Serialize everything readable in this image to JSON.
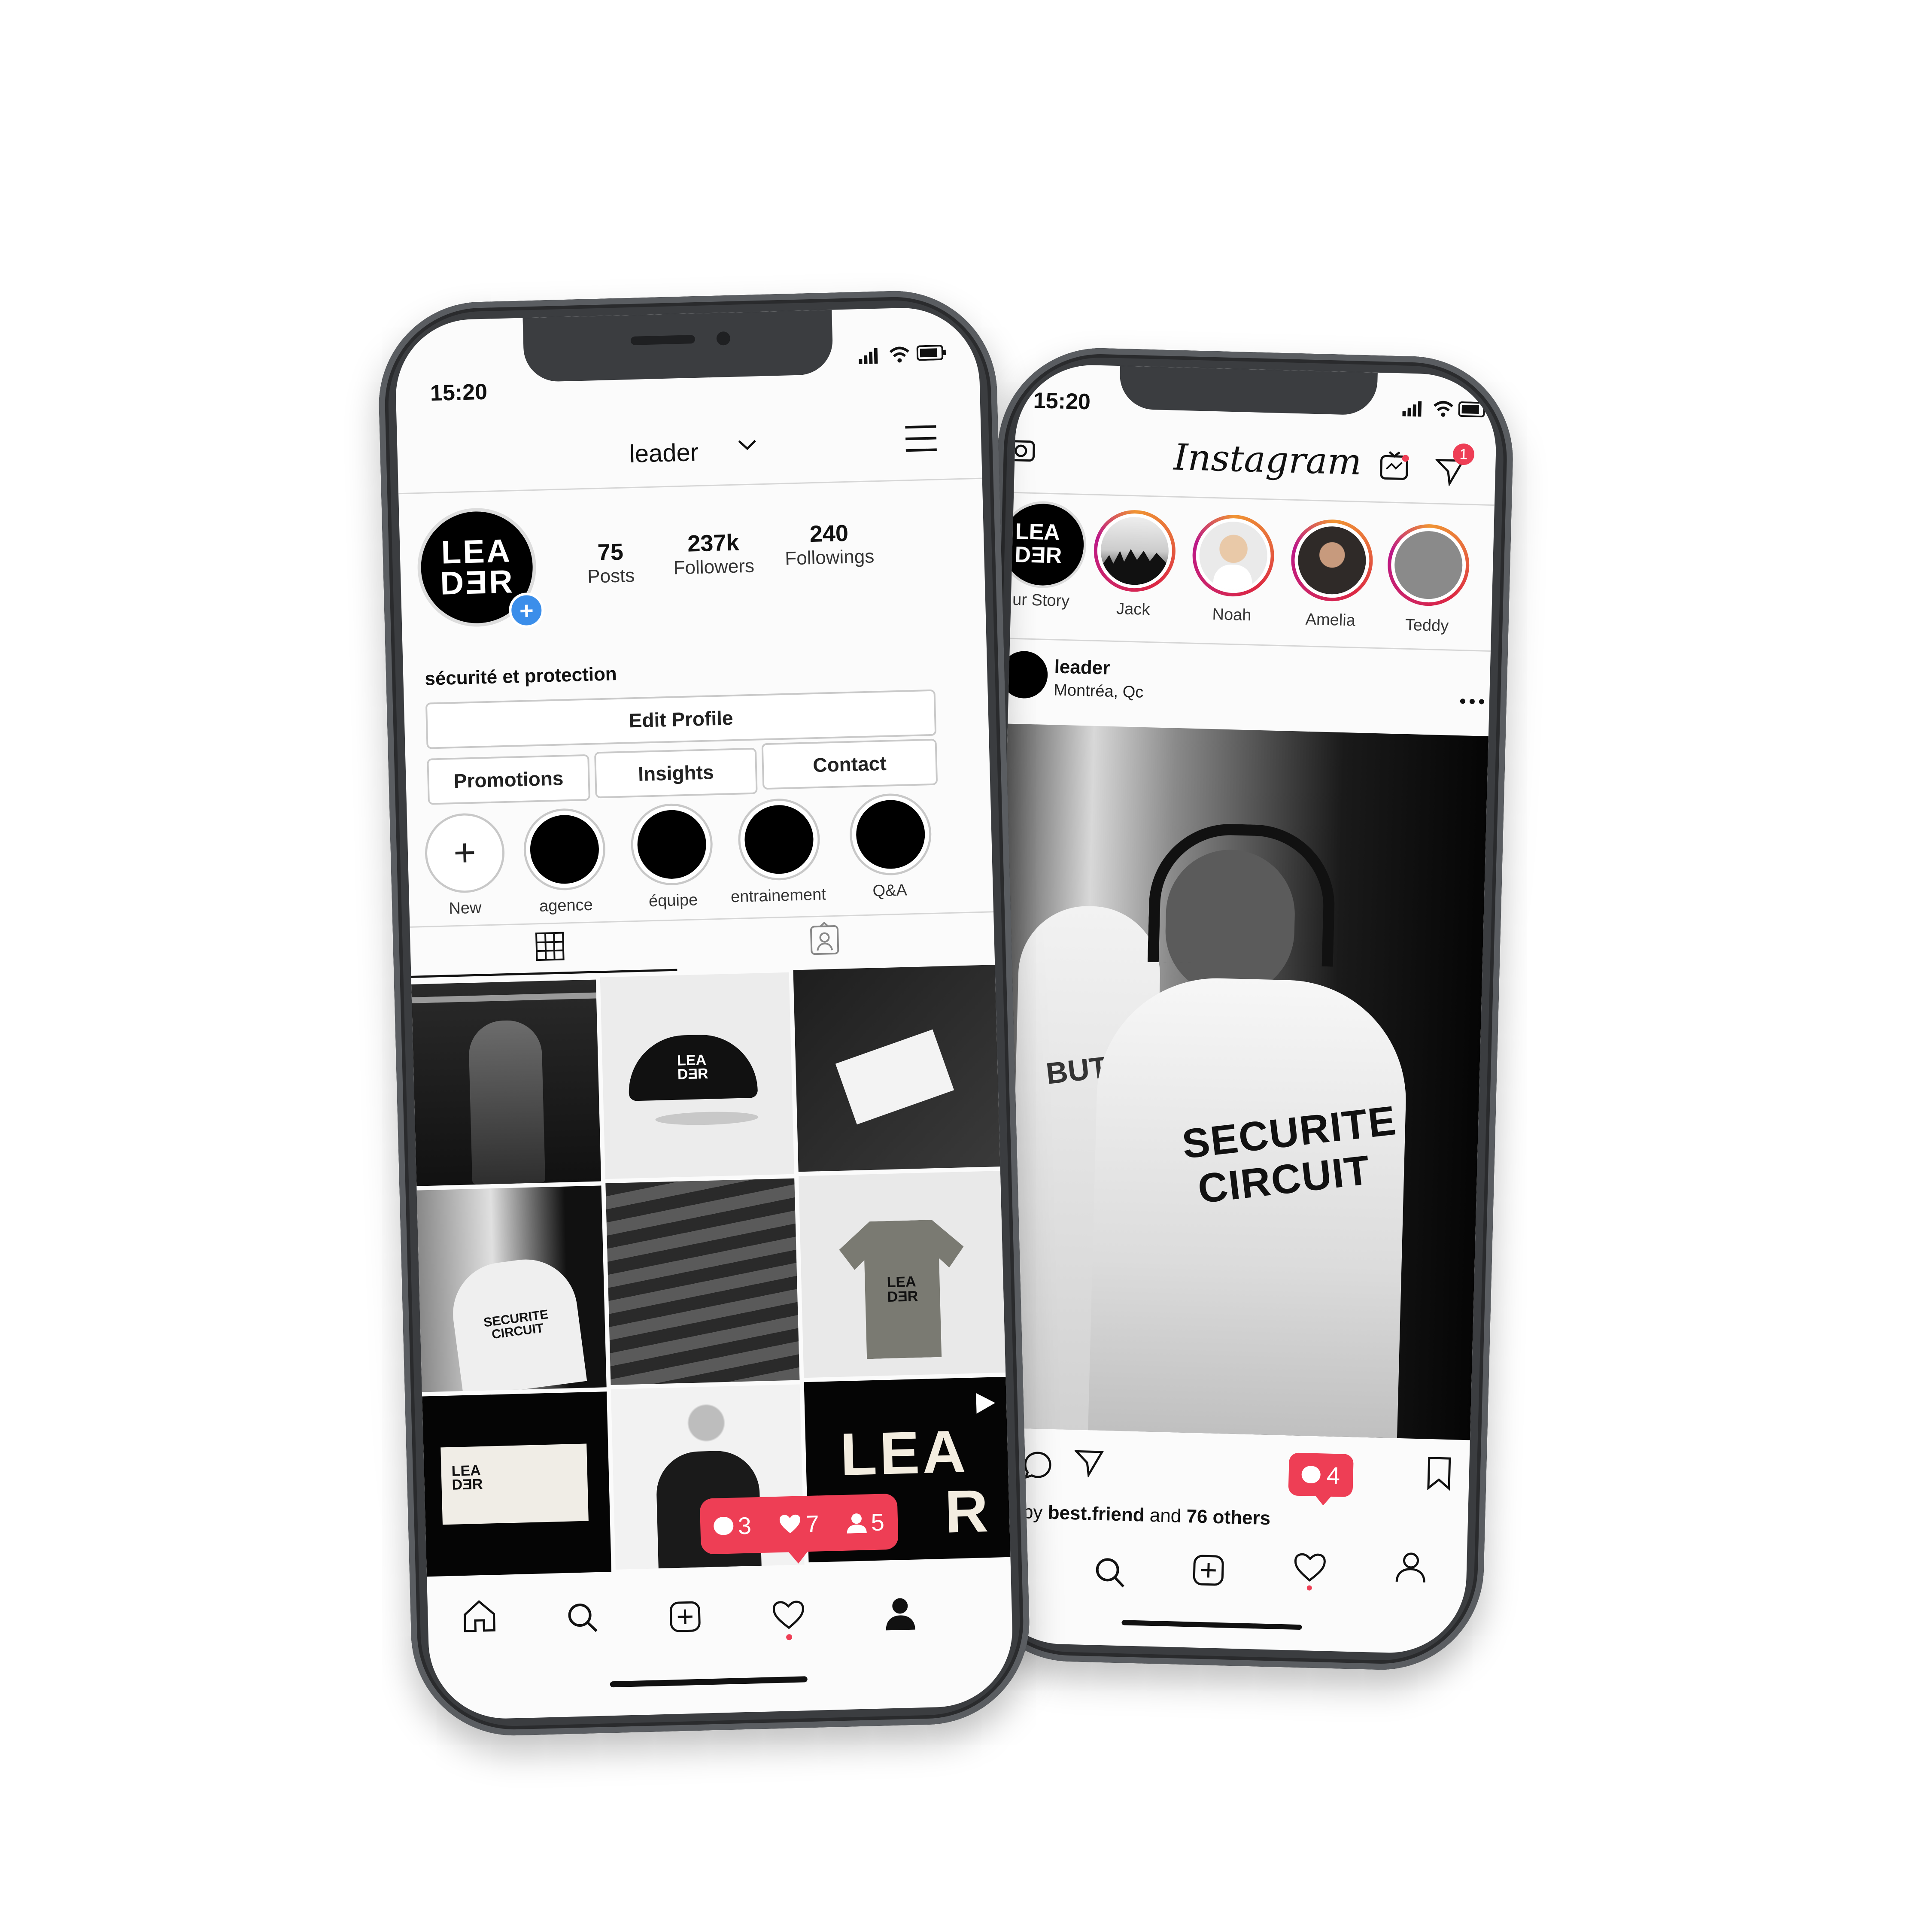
{
  "colors": {
    "accent_red": "#ee3e55",
    "add_blue": "#3b8eea",
    "frame": "#3b3d40"
  },
  "left_phone": {
    "status_time": "15:20",
    "header": {
      "username": "leader"
    },
    "avatar": {
      "line1": "LEA",
      "line2": "DƎR"
    },
    "stats": [
      {
        "value": "75",
        "label": "Posts"
      },
      {
        "value": "237k",
        "label": "Followers"
      },
      {
        "value": "240",
        "label": "Followings"
      }
    ],
    "bio": "sécurité et protection",
    "buttons": {
      "edit": "Edit Profile",
      "promotions": "Promotions",
      "insights": "Insights",
      "contact": "Contact"
    },
    "highlights": [
      "New",
      "agence",
      "équipe",
      "entrainement",
      "Q&A"
    ],
    "grid": {
      "cap_logo": "LEA\nDƎR",
      "tshirt_logo": "LEA\nDƎR",
      "shirt_text": "SECURITE\nCIRCUIT",
      "card_logo": "LEA\nDƎR",
      "big_logo_1": "LEA",
      "big_logo_2": "R"
    },
    "notification": {
      "comments": "3",
      "likes": "7",
      "follows": "5"
    }
  },
  "right_phone": {
    "status_time": "15:20",
    "app_title": "Instagram",
    "dm_count": "1",
    "stories": [
      {
        "name": "Your Story",
        "display": "ur Story"
      },
      {
        "name": "Jack"
      },
      {
        "name": "Noah"
      },
      {
        "name": "Amelia"
      },
      {
        "name": "Teddy"
      }
    ],
    "post": {
      "username": "leader",
      "location": "Montréa, Qc",
      "shirt_text_1": "SECURITE",
      "shirt_text_2": "CIRCUIT",
      "back_text": "BUTT",
      "liked_prefix": "iked by",
      "liked_user": "best.friend",
      "liked_and": "and",
      "liked_others": "76 others"
    },
    "comment_badge": "4"
  }
}
